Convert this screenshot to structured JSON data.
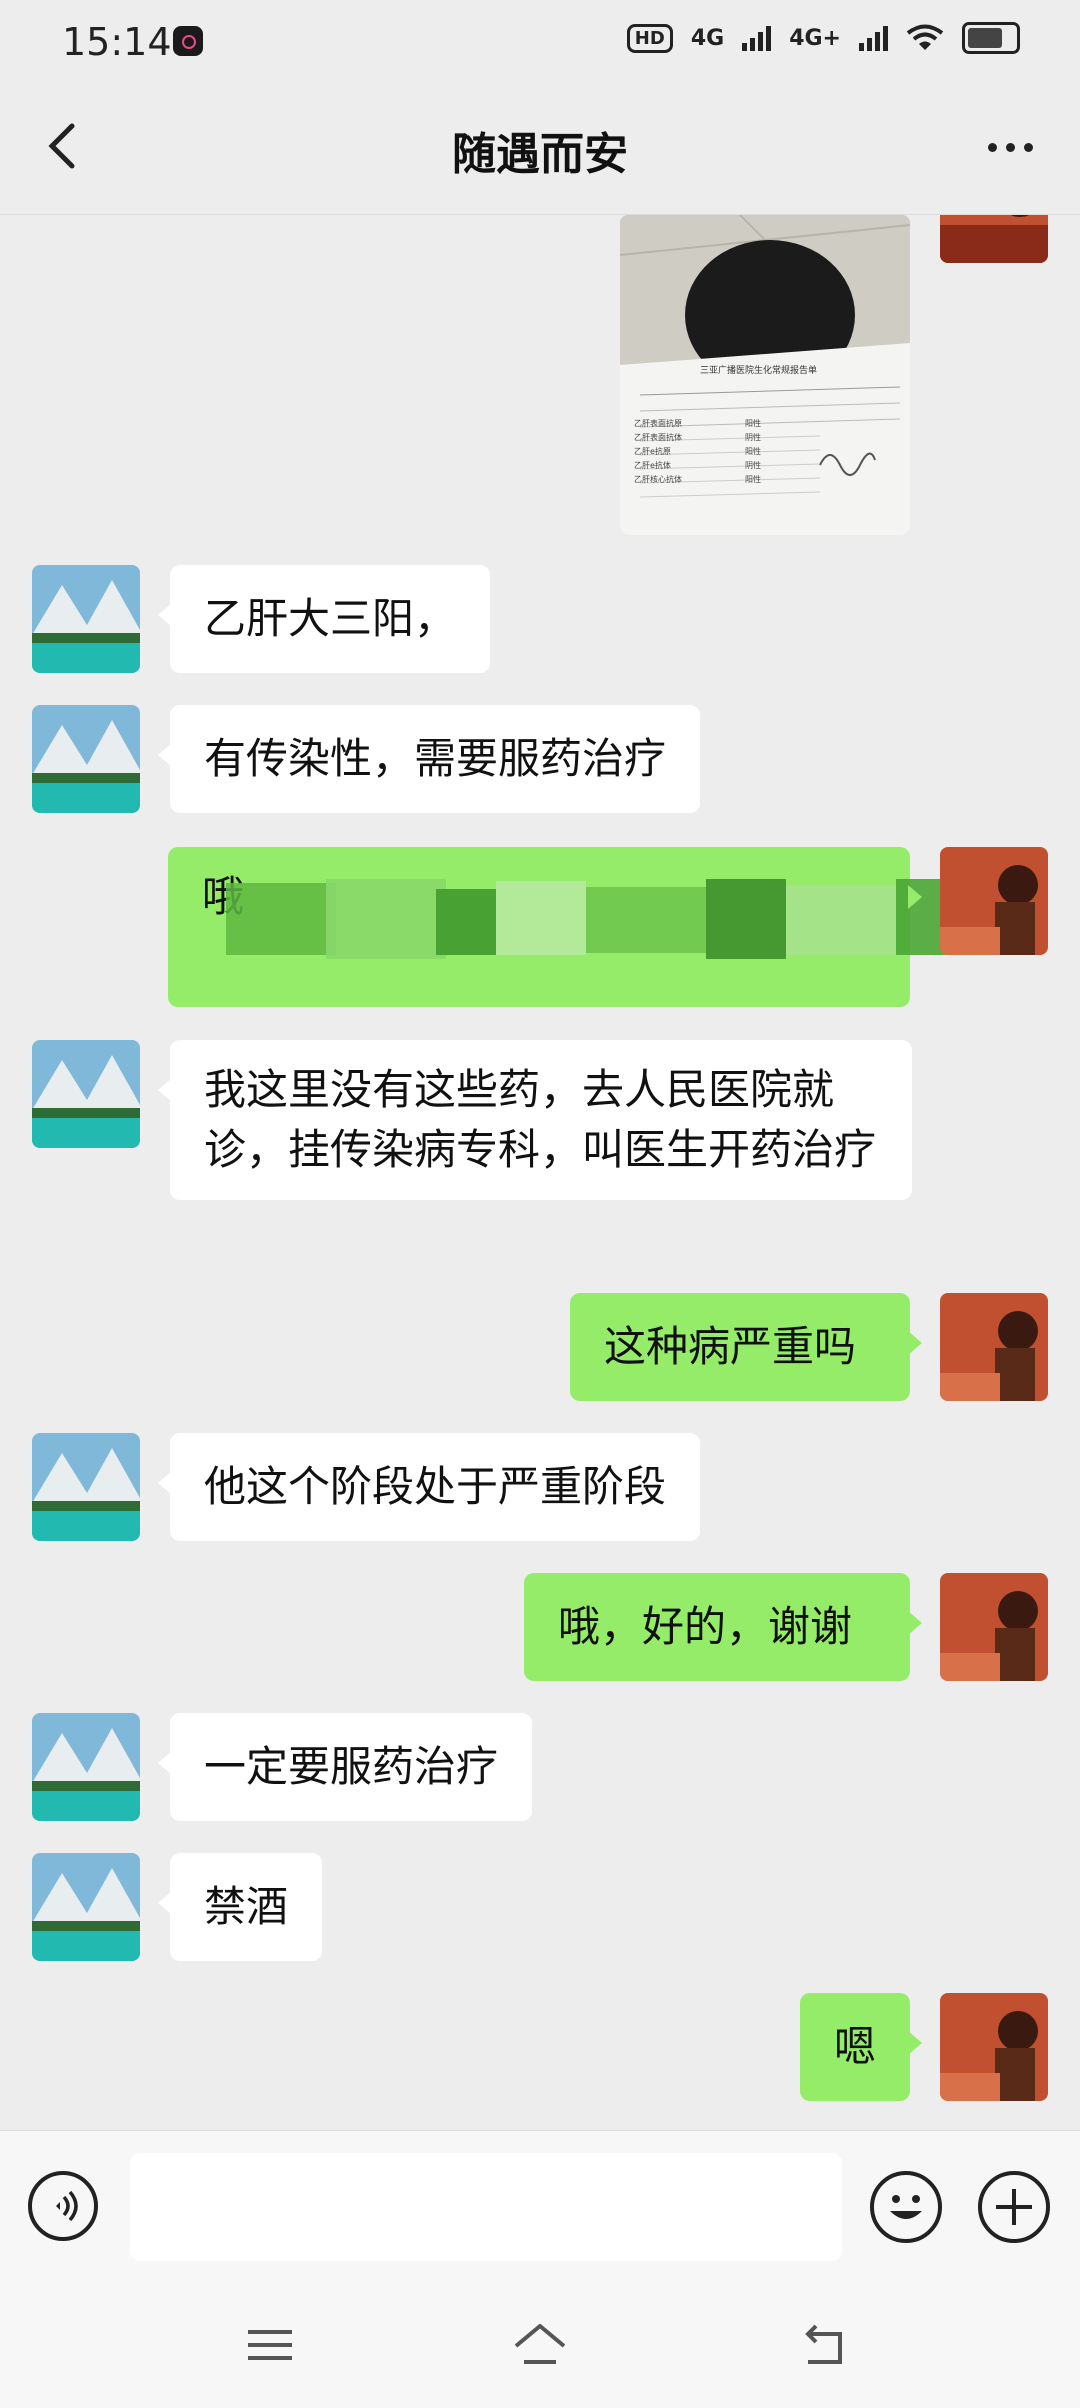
{
  "status_bar": {
    "time": "15:14",
    "hd_label": "HD",
    "net1": "4G",
    "net2": "4G+"
  },
  "header": {
    "title": "随遇而安"
  },
  "messages": {
    "m1": "乙肝大三阳，",
    "m2": "有传染性，需要服药治疗",
    "m3": "哦",
    "m4": "我这里没有这些药，去人民医院就诊，挂传染病专科，叫医生开药治疗",
    "m5": "这种病严重吗",
    "m6": "他这个阶段处于严重阶段",
    "m7": "哦，好的，谢谢",
    "m8": "一定要服药治疗",
    "m9": "禁酒",
    "m10": "嗯"
  },
  "report_image": {
    "title": "三亚广播医院生化常规报告单",
    "rows": [
      "乙肝表面抗原",
      "乙肝表面抗体",
      "乙肝e抗原",
      "乙肝e抗体",
      "乙肝核心抗体"
    ],
    "results": [
      "阳性",
      "阴性",
      "阳性",
      "阴性",
      "阳性"
    ]
  },
  "colors": {
    "bg": "#ededed",
    "green_bubble": "#95ec69",
    "white_bubble": "#ffffff"
  },
  "icons": {
    "back": "chevron-left-icon",
    "more": "more-dots-icon",
    "voice": "voice-icon",
    "emoji": "emoji-icon",
    "plus": "plus-icon"
  }
}
